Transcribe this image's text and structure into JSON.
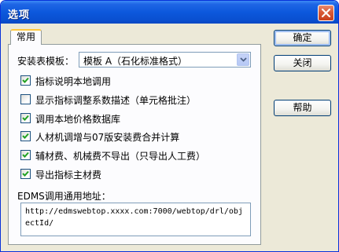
{
  "window": {
    "title": "选项",
    "close_icon": "close-icon"
  },
  "tabs": [
    {
      "label": "常用",
      "active": true
    }
  ],
  "template": {
    "label": "安装表模板：",
    "selected": "模板 A（石化标准格式）"
  },
  "options": [
    {
      "label": "指标说明本地调用",
      "checked": true
    },
    {
      "label": "显示指标调整系数描述（单元格批注）",
      "checked": false
    },
    {
      "label": "调用本地价格数据库",
      "checked": true
    },
    {
      "label": "人材机调增与07版安装费合并计算",
      "checked": true
    },
    {
      "label": "辅材费、机械费不导出（只导出人工费）",
      "checked": true
    },
    {
      "label": "导出指标主材费",
      "checked": true
    }
  ],
  "edms": {
    "label": "EDMS调用通用地址：",
    "value": "http://edmswebtop.xxxx.com:7000/webtop/drl/objectId/"
  },
  "buttons": {
    "ok": "确定",
    "close": "关闭",
    "help": "帮助"
  },
  "colors": {
    "titlebar": "#0c58dc",
    "dialog_bg": "#ece9d8",
    "tab_accent": "#ffc83c",
    "check_mark": "#21a121"
  }
}
